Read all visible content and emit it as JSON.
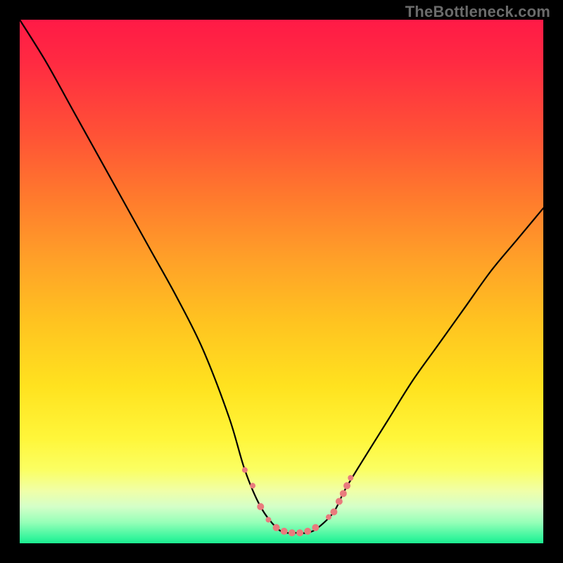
{
  "watermark": "TheBottleneck.com",
  "chart_data": {
    "type": "line",
    "title": "",
    "xlabel": "",
    "ylabel": "",
    "xlim": [
      0,
      100
    ],
    "ylim": [
      0,
      100
    ],
    "series": [
      {
        "name": "bottleneck-curve",
        "x": [
          0,
          5,
          10,
          15,
          20,
          25,
          30,
          35,
          40,
          43,
          46,
          49,
          51,
          53,
          55,
          57,
          60,
          62,
          65,
          70,
          75,
          80,
          85,
          90,
          95,
          100
        ],
        "y": [
          100,
          92,
          83,
          74,
          65,
          56,
          47,
          37,
          24,
          14,
          7,
          3,
          2,
          2,
          2,
          3,
          6,
          10,
          15,
          23,
          31,
          38,
          45,
          52,
          58,
          64
        ]
      }
    ],
    "markers": {
      "name": "curve-markers",
      "color": "#e97b7d",
      "points": [
        {
          "x": 43.0,
          "y": 14.0,
          "r": 4
        },
        {
          "x": 44.5,
          "y": 11.0,
          "r": 4
        },
        {
          "x": 46.0,
          "y": 7.0,
          "r": 5
        },
        {
          "x": 47.5,
          "y": 4.5,
          "r": 4
        },
        {
          "x": 49.0,
          "y": 3.0,
          "r": 5
        },
        {
          "x": 50.5,
          "y": 2.3,
          "r": 5
        },
        {
          "x": 52.0,
          "y": 2.0,
          "r": 5
        },
        {
          "x": 53.5,
          "y": 2.0,
          "r": 5
        },
        {
          "x": 55.0,
          "y": 2.3,
          "r": 5
        },
        {
          "x": 56.5,
          "y": 3.0,
          "r": 5
        },
        {
          "x": 59.0,
          "y": 5.0,
          "r": 4
        },
        {
          "x": 60.0,
          "y": 6.0,
          "r": 5
        },
        {
          "x": 61.0,
          "y": 8.0,
          "r": 5
        },
        {
          "x": 61.8,
          "y": 9.5,
          "r": 5
        },
        {
          "x": 62.5,
          "y": 11.0,
          "r": 5
        },
        {
          "x": 63.2,
          "y": 12.5,
          "r": 4
        }
      ]
    },
    "gradient_stops": [
      {
        "pos": 0,
        "color": "#ff1a46"
      },
      {
        "pos": 8,
        "color": "#ff2a42"
      },
      {
        "pos": 22,
        "color": "#ff5236"
      },
      {
        "pos": 34,
        "color": "#ff7a2d"
      },
      {
        "pos": 46,
        "color": "#ffa128"
      },
      {
        "pos": 58,
        "color": "#ffc420"
      },
      {
        "pos": 70,
        "color": "#ffe21f"
      },
      {
        "pos": 80,
        "color": "#fff63a"
      },
      {
        "pos": 86,
        "color": "#fbff63"
      },
      {
        "pos": 90,
        "color": "#f0ffa8"
      },
      {
        "pos": 93,
        "color": "#d4ffc8"
      },
      {
        "pos": 96,
        "color": "#96ffb8"
      },
      {
        "pos": 99,
        "color": "#35f59c"
      },
      {
        "pos": 100,
        "color": "#1ceb8f"
      }
    ]
  }
}
